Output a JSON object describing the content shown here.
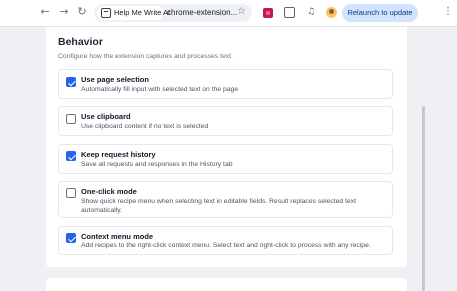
{
  "browser": {
    "site_name": "Help Me Write AI",
    "url": "chrome-extension...",
    "relaunch_label": "Relaunch to update",
    "icons": [
      "back-icon",
      "forward-icon",
      "reload-icon",
      "bookmark-star-icon",
      "extension-icon",
      "puzzle-icon",
      "media-icon",
      "profile-avatar",
      "menu-icon"
    ]
  },
  "behavior": {
    "title": "Behavior",
    "description": "Configure how the extension captures and processes text.",
    "options": [
      {
        "label": "Use page selection",
        "description": "Automatically fill input with selected text on the page",
        "checked": true
      },
      {
        "label": "Use clipboard",
        "description": "Use clipboard content if no text is selected",
        "checked": false
      },
      {
        "label": "Keep request history",
        "description": "Save all requests and responses in the History tab",
        "checked": true
      },
      {
        "label": "One-click mode",
        "description": "Show quick recipe menu when selecting text in editable fields. Result replaces selected text automatically.",
        "checked": false
      },
      {
        "label": "Context menu mode",
        "description": "Add recipes to the right-click context menu. Select text and right-click to process with any recipe.",
        "checked": true
      }
    ]
  },
  "colors": {
    "accent": "#2563eb",
    "relaunch_bg": "#d3e3fd"
  }
}
